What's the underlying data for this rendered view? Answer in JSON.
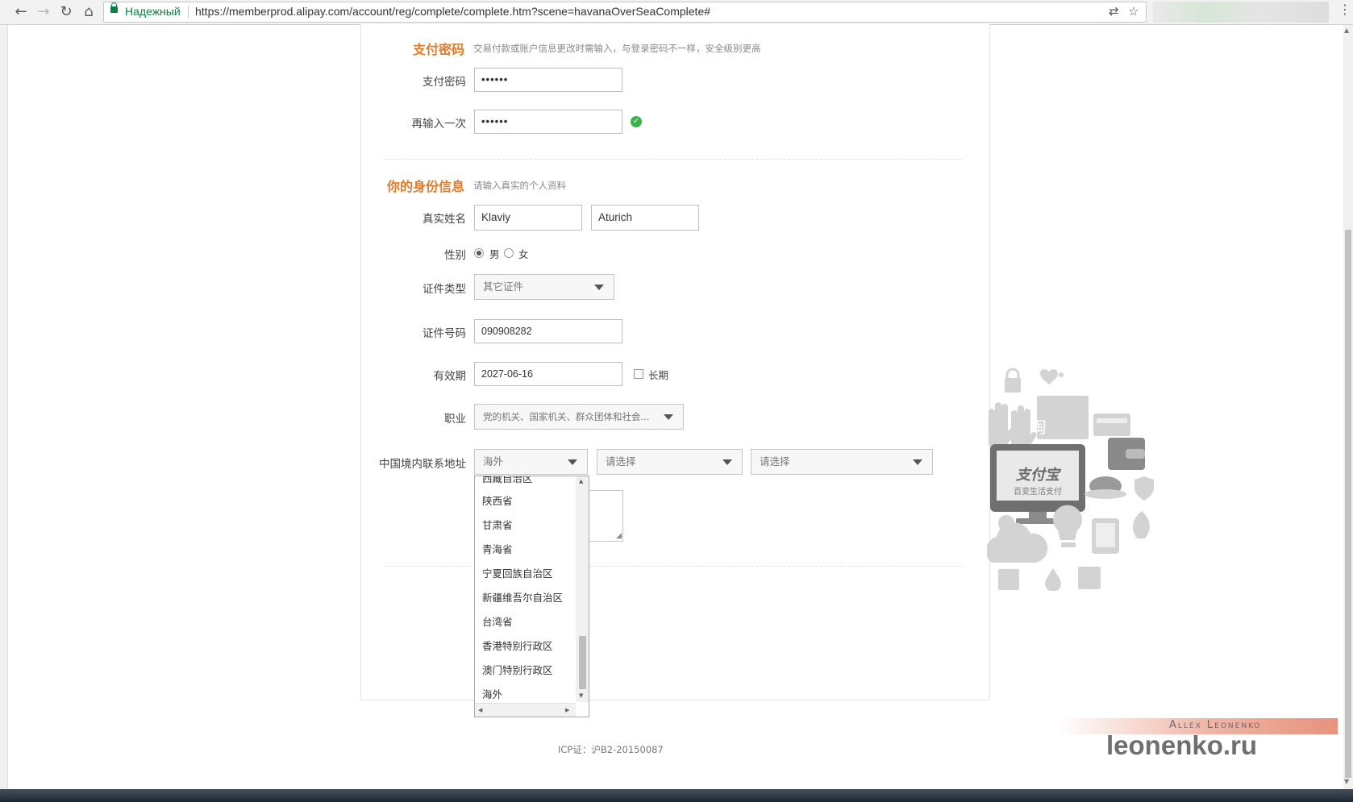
{
  "browser": {
    "secure_label": "Надежный",
    "url": "https://memberprod.alipay.com/account/reg/complete/complete.htm?scene=havanaOverSeaComplete#"
  },
  "password_section": {
    "title": "支付密码",
    "description": "交易付款或账户信息更改时需输入，与登录密码不一样，安全级别更高",
    "pay_password_label": "支付密码",
    "pay_password_value": "••••••",
    "confirm_label": "再输入一次",
    "confirm_value": "••••••"
  },
  "identity_section": {
    "title": "你的身份信息",
    "description": "请输入真实的个人资料",
    "real_name_label": "真实姓名",
    "first_name": "Klaviy",
    "last_name": "Aturich",
    "gender_label": "性别",
    "gender_options": [
      "男",
      "女"
    ],
    "gender_selected": "男",
    "id_type_label": "证件类型",
    "id_type_value": "其它证件",
    "id_number_label": "证件号码",
    "id_number_value": "090908282",
    "validity_label": "有效期",
    "validity_value": "2027-06-16",
    "long_term_label": "长期",
    "occupation_label": "职业",
    "occupation_value": "党的机关、国家机关、群众团体和社会...",
    "address_label": "中国境内联系地址",
    "province_value": "海外",
    "city_value": "请选择",
    "district_value": "请选择"
  },
  "province_dropdown": {
    "items": [
      "西藏自治区",
      "陕西省",
      "甘肃省",
      "青海省",
      "宁夏回族自治区",
      "新疆维吾尔自治区",
      "台湾省",
      "香港特别行政区",
      "澳门特别行政区",
      "海外"
    ]
  },
  "illustration": {
    "logo_text": "支付宝",
    "tagline": "百变生活支付",
    "tao_char": "淘"
  },
  "footer": {
    "icp": "ICP证：沪B2-20150087"
  },
  "watermark": {
    "name": "Allex Leonenko",
    "site": "leonenko.ru"
  },
  "colors": {
    "accent_orange": "#e07b2a",
    "success_green": "#3ab24a",
    "secure_green": "#0b8043"
  }
}
